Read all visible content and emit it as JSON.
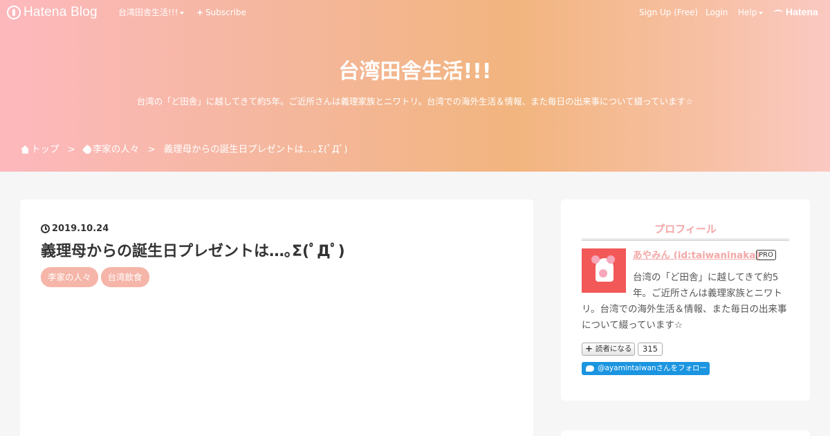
{
  "globalbar": {
    "logo_text": "Hatena Blog",
    "blog_menu": "台湾田舎生活!!!",
    "subscribe": "Subscribe",
    "signup": "Sign Up (Free)",
    "login": "Login",
    "help": "Help",
    "hatena": "Hatena"
  },
  "header": {
    "title": "台湾田舎生活!!!",
    "description": "台湾の「ど田舎」に越してきて約5年。ご近所さんは義理家族とニワトリ。台湾での海外生活＆情報、また毎日の出来事について綴っています☆",
    "breadcrumb": {
      "home": "トップ",
      "sep": ">",
      "category": "李家の人々",
      "current": "義理母からの誕生日プレゼントは…｡Σ(ﾟДﾟ)"
    }
  },
  "entry": {
    "date": "2019.10.24",
    "title": "義理母からの誕生日プレゼントは…｡Σ(ﾟДﾟ)",
    "categories": [
      "李家の人々",
      "台湾飲食"
    ]
  },
  "profile": {
    "heading": "プロフィール",
    "name": "あやみん (id:taiwaninaka)",
    "badge": "PRO",
    "text": "台湾の「ど田舎」に越してきて約5年。ご近所さんは義理家族とニワトリ。台湾での海外生活＆情報、また毎日の出来事について綴っています☆",
    "reader_button": "読者になる",
    "reader_count": "315",
    "twitter_follow": "@ayamintaiwanさんをフォロー"
  },
  "colors": {
    "accent": "#f4a7a7",
    "category_bg": "#f5b5a8",
    "twitter": "#1b95e0"
  }
}
